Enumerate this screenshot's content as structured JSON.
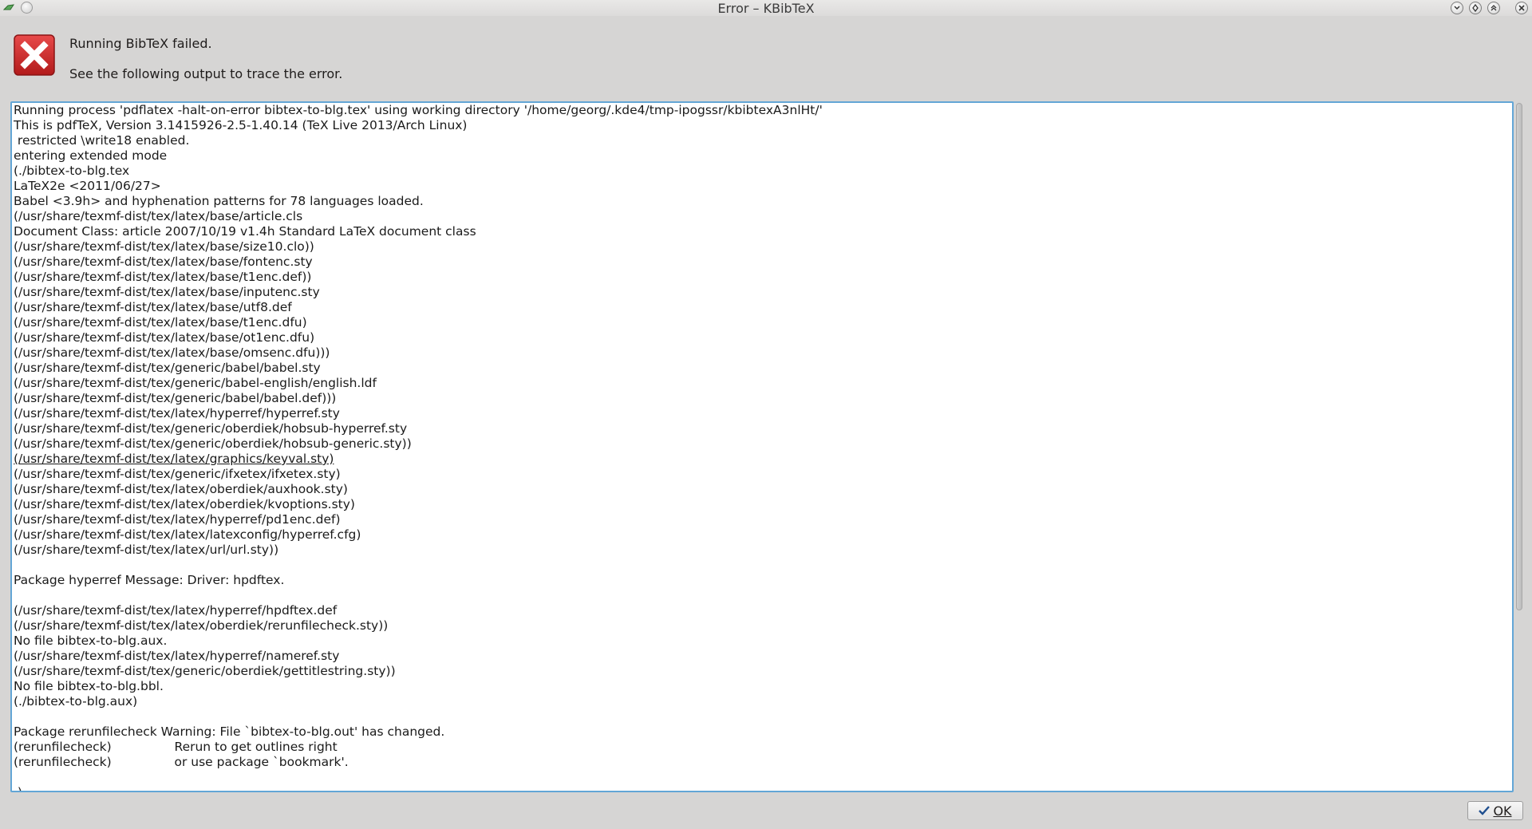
{
  "window": {
    "title": "Error – KBibTeX"
  },
  "message": {
    "primary": "Running BibTeX failed.",
    "secondary": "See the following output to trace the error."
  },
  "output": {
    "lines": [
      "Running process 'pdflatex -halt-on-error bibtex-to-blg.tex' using working directory '/home/georg/.kde4/tmp-ipogssr/kbibtexA3nlHt/'",
      "This is pdfTeX, Version 3.1415926-2.5-1.40.14 (TeX Live 2013/Arch Linux)",
      " restricted \\write18 enabled.",
      "entering extended mode",
      "(./bibtex-to-blg.tex",
      "LaTeX2e <2011/06/27>",
      "Babel <3.9h> and hyphenation patterns for 78 languages loaded.",
      "(/usr/share/texmf-dist/tex/latex/base/article.cls",
      "Document Class: article 2007/10/19 v1.4h Standard LaTeX document class",
      "(/usr/share/texmf-dist/tex/latex/base/size10.clo))",
      "(/usr/share/texmf-dist/tex/latex/base/fontenc.sty",
      "(/usr/share/texmf-dist/tex/latex/base/t1enc.def))",
      "(/usr/share/texmf-dist/tex/latex/base/inputenc.sty",
      "(/usr/share/texmf-dist/tex/latex/base/utf8.def",
      "(/usr/share/texmf-dist/tex/latex/base/t1enc.dfu)",
      "(/usr/share/texmf-dist/tex/latex/base/ot1enc.dfu)",
      "(/usr/share/texmf-dist/tex/latex/base/omsenc.dfu)))",
      "(/usr/share/texmf-dist/tex/generic/babel/babel.sty",
      "(/usr/share/texmf-dist/tex/generic/babel-english/english.ldf",
      "(/usr/share/texmf-dist/tex/generic/babel/babel.def)))",
      "(/usr/share/texmf-dist/tex/latex/hyperref/hyperref.sty",
      "(/usr/share/texmf-dist/tex/generic/oberdiek/hobsub-hyperref.sty",
      "(/usr/share/texmf-dist/tex/generic/oberdiek/hobsub-generic.sty))",
      "(/usr/share/texmf-dist/tex/latex/graphics/keyval.sty)",
      "(/usr/share/texmf-dist/tex/generic/ifxetex/ifxetex.sty)",
      "(/usr/share/texmf-dist/tex/latex/oberdiek/auxhook.sty)",
      "(/usr/share/texmf-dist/tex/latex/oberdiek/kvoptions.sty)",
      "(/usr/share/texmf-dist/tex/latex/hyperref/pd1enc.def)",
      "(/usr/share/texmf-dist/tex/latex/latexconfig/hyperref.cfg)",
      "(/usr/share/texmf-dist/tex/latex/url/url.sty))",
      "",
      "Package hyperref Message: Driver: hpdftex.",
      "",
      "(/usr/share/texmf-dist/tex/latex/hyperref/hpdftex.def",
      "(/usr/share/texmf-dist/tex/latex/oberdiek/rerunfilecheck.sty))",
      "No file bibtex-to-blg.aux.",
      "(/usr/share/texmf-dist/tex/latex/hyperref/nameref.sty",
      "(/usr/share/texmf-dist/tex/generic/oberdiek/gettitlestring.sty))",
      "No file bibtex-to-blg.bbl.",
      "(./bibtex-to-blg.aux)",
      "",
      "Package rerunfilecheck Warning: File `bibtex-to-blg.out' has changed.",
      "(rerunfilecheck)                Rerun to get outlines right",
      "(rerunfilecheck)                or use package `bookmark'.",
      "",
      " )"
    ]
  },
  "buttons": {
    "ok_label": "OK"
  },
  "icons": {
    "app": "kbibtex-app-icon",
    "titlebar_menu": "window-menu-icon",
    "minimize": "minimize-icon",
    "maximize": "maximize-icon",
    "keep_above": "keep-above-icon",
    "close": "close-icon",
    "error": "error-icon",
    "ok": "checkmark-icon"
  },
  "colors": {
    "error_red": "#cc2727",
    "focus_border": "#63a6d6"
  }
}
